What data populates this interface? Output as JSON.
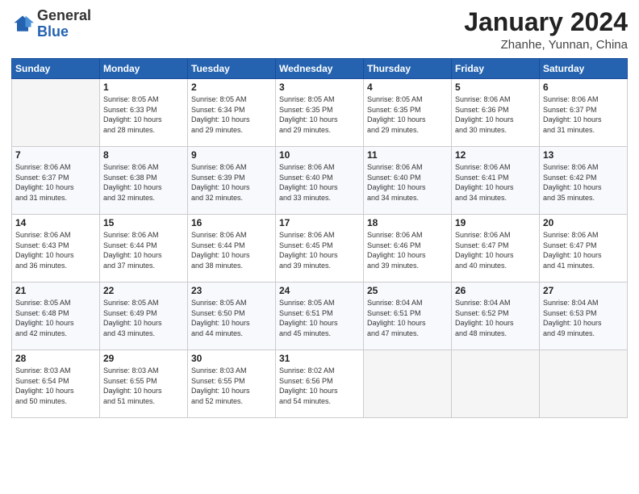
{
  "header": {
    "logo_general": "General",
    "logo_blue": "Blue",
    "month": "January 2024",
    "location": "Zhanhe, Yunnan, China"
  },
  "days_of_week": [
    "Sunday",
    "Monday",
    "Tuesday",
    "Wednesday",
    "Thursday",
    "Friday",
    "Saturday"
  ],
  "weeks": [
    [
      {
        "day": "",
        "info": ""
      },
      {
        "day": "1",
        "info": "Sunrise: 8:05 AM\nSunset: 6:33 PM\nDaylight: 10 hours\nand 28 minutes."
      },
      {
        "day": "2",
        "info": "Sunrise: 8:05 AM\nSunset: 6:34 PM\nDaylight: 10 hours\nand 29 minutes."
      },
      {
        "day": "3",
        "info": "Sunrise: 8:05 AM\nSunset: 6:35 PM\nDaylight: 10 hours\nand 29 minutes."
      },
      {
        "day": "4",
        "info": "Sunrise: 8:05 AM\nSunset: 6:35 PM\nDaylight: 10 hours\nand 29 minutes."
      },
      {
        "day": "5",
        "info": "Sunrise: 8:06 AM\nSunset: 6:36 PM\nDaylight: 10 hours\nand 30 minutes."
      },
      {
        "day": "6",
        "info": "Sunrise: 8:06 AM\nSunset: 6:37 PM\nDaylight: 10 hours\nand 31 minutes."
      }
    ],
    [
      {
        "day": "7",
        "info": "Sunrise: 8:06 AM\nSunset: 6:37 PM\nDaylight: 10 hours\nand 31 minutes."
      },
      {
        "day": "8",
        "info": "Sunrise: 8:06 AM\nSunset: 6:38 PM\nDaylight: 10 hours\nand 32 minutes."
      },
      {
        "day": "9",
        "info": "Sunrise: 8:06 AM\nSunset: 6:39 PM\nDaylight: 10 hours\nand 32 minutes."
      },
      {
        "day": "10",
        "info": "Sunrise: 8:06 AM\nSunset: 6:40 PM\nDaylight: 10 hours\nand 33 minutes."
      },
      {
        "day": "11",
        "info": "Sunrise: 8:06 AM\nSunset: 6:40 PM\nDaylight: 10 hours\nand 34 minutes."
      },
      {
        "day": "12",
        "info": "Sunrise: 8:06 AM\nSunset: 6:41 PM\nDaylight: 10 hours\nand 34 minutes."
      },
      {
        "day": "13",
        "info": "Sunrise: 8:06 AM\nSunset: 6:42 PM\nDaylight: 10 hours\nand 35 minutes."
      }
    ],
    [
      {
        "day": "14",
        "info": "Sunrise: 8:06 AM\nSunset: 6:43 PM\nDaylight: 10 hours\nand 36 minutes."
      },
      {
        "day": "15",
        "info": "Sunrise: 8:06 AM\nSunset: 6:44 PM\nDaylight: 10 hours\nand 37 minutes."
      },
      {
        "day": "16",
        "info": "Sunrise: 8:06 AM\nSunset: 6:44 PM\nDaylight: 10 hours\nand 38 minutes."
      },
      {
        "day": "17",
        "info": "Sunrise: 8:06 AM\nSunset: 6:45 PM\nDaylight: 10 hours\nand 39 minutes."
      },
      {
        "day": "18",
        "info": "Sunrise: 8:06 AM\nSunset: 6:46 PM\nDaylight: 10 hours\nand 39 minutes."
      },
      {
        "day": "19",
        "info": "Sunrise: 8:06 AM\nSunset: 6:47 PM\nDaylight: 10 hours\nand 40 minutes."
      },
      {
        "day": "20",
        "info": "Sunrise: 8:06 AM\nSunset: 6:47 PM\nDaylight: 10 hours\nand 41 minutes."
      }
    ],
    [
      {
        "day": "21",
        "info": "Sunrise: 8:05 AM\nSunset: 6:48 PM\nDaylight: 10 hours\nand 42 minutes."
      },
      {
        "day": "22",
        "info": "Sunrise: 8:05 AM\nSunset: 6:49 PM\nDaylight: 10 hours\nand 43 minutes."
      },
      {
        "day": "23",
        "info": "Sunrise: 8:05 AM\nSunset: 6:50 PM\nDaylight: 10 hours\nand 44 minutes."
      },
      {
        "day": "24",
        "info": "Sunrise: 8:05 AM\nSunset: 6:51 PM\nDaylight: 10 hours\nand 45 minutes."
      },
      {
        "day": "25",
        "info": "Sunrise: 8:04 AM\nSunset: 6:51 PM\nDaylight: 10 hours\nand 47 minutes."
      },
      {
        "day": "26",
        "info": "Sunrise: 8:04 AM\nSunset: 6:52 PM\nDaylight: 10 hours\nand 48 minutes."
      },
      {
        "day": "27",
        "info": "Sunrise: 8:04 AM\nSunset: 6:53 PM\nDaylight: 10 hours\nand 49 minutes."
      }
    ],
    [
      {
        "day": "28",
        "info": "Sunrise: 8:03 AM\nSunset: 6:54 PM\nDaylight: 10 hours\nand 50 minutes."
      },
      {
        "day": "29",
        "info": "Sunrise: 8:03 AM\nSunset: 6:55 PM\nDaylight: 10 hours\nand 51 minutes."
      },
      {
        "day": "30",
        "info": "Sunrise: 8:03 AM\nSunset: 6:55 PM\nDaylight: 10 hours\nand 52 minutes."
      },
      {
        "day": "31",
        "info": "Sunrise: 8:02 AM\nSunset: 6:56 PM\nDaylight: 10 hours\nand 54 minutes."
      },
      {
        "day": "",
        "info": ""
      },
      {
        "day": "",
        "info": ""
      },
      {
        "day": "",
        "info": ""
      }
    ]
  ]
}
